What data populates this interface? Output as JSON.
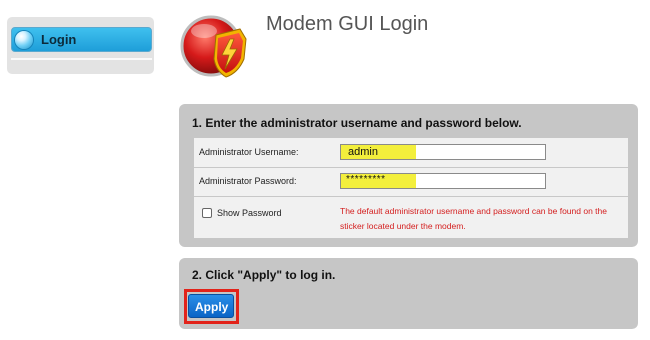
{
  "sidebar": {
    "items": [
      {
        "label": "Login",
        "icon": "globe-icon",
        "active": true
      }
    ]
  },
  "header": {
    "title": "Modem GUI Login",
    "logo_icon": "shield-lightning-logo"
  },
  "step1": {
    "heading": "1. Enter the administrator username and password below.",
    "username_label": "Administrator Username:",
    "username_value": "admin",
    "password_label": "Administrator Password:",
    "password_value": "*********",
    "show_password_label": "Show Password",
    "show_password_checked": false,
    "note": "The default administrator username and password can be found on the sticker located under the modem."
  },
  "step2": {
    "heading": "2. Click \"Apply\" to log in.",
    "apply_label": "Apply"
  },
  "colors": {
    "panel_bg": "#c6c6c6",
    "form_bg": "#f1f1f1",
    "note_text": "#d42020",
    "field_highlight": "#f3ef3c",
    "apply_button": "#1478d8",
    "callout_border": "#e2231a",
    "sidebar_active": "#2bb0e6"
  }
}
